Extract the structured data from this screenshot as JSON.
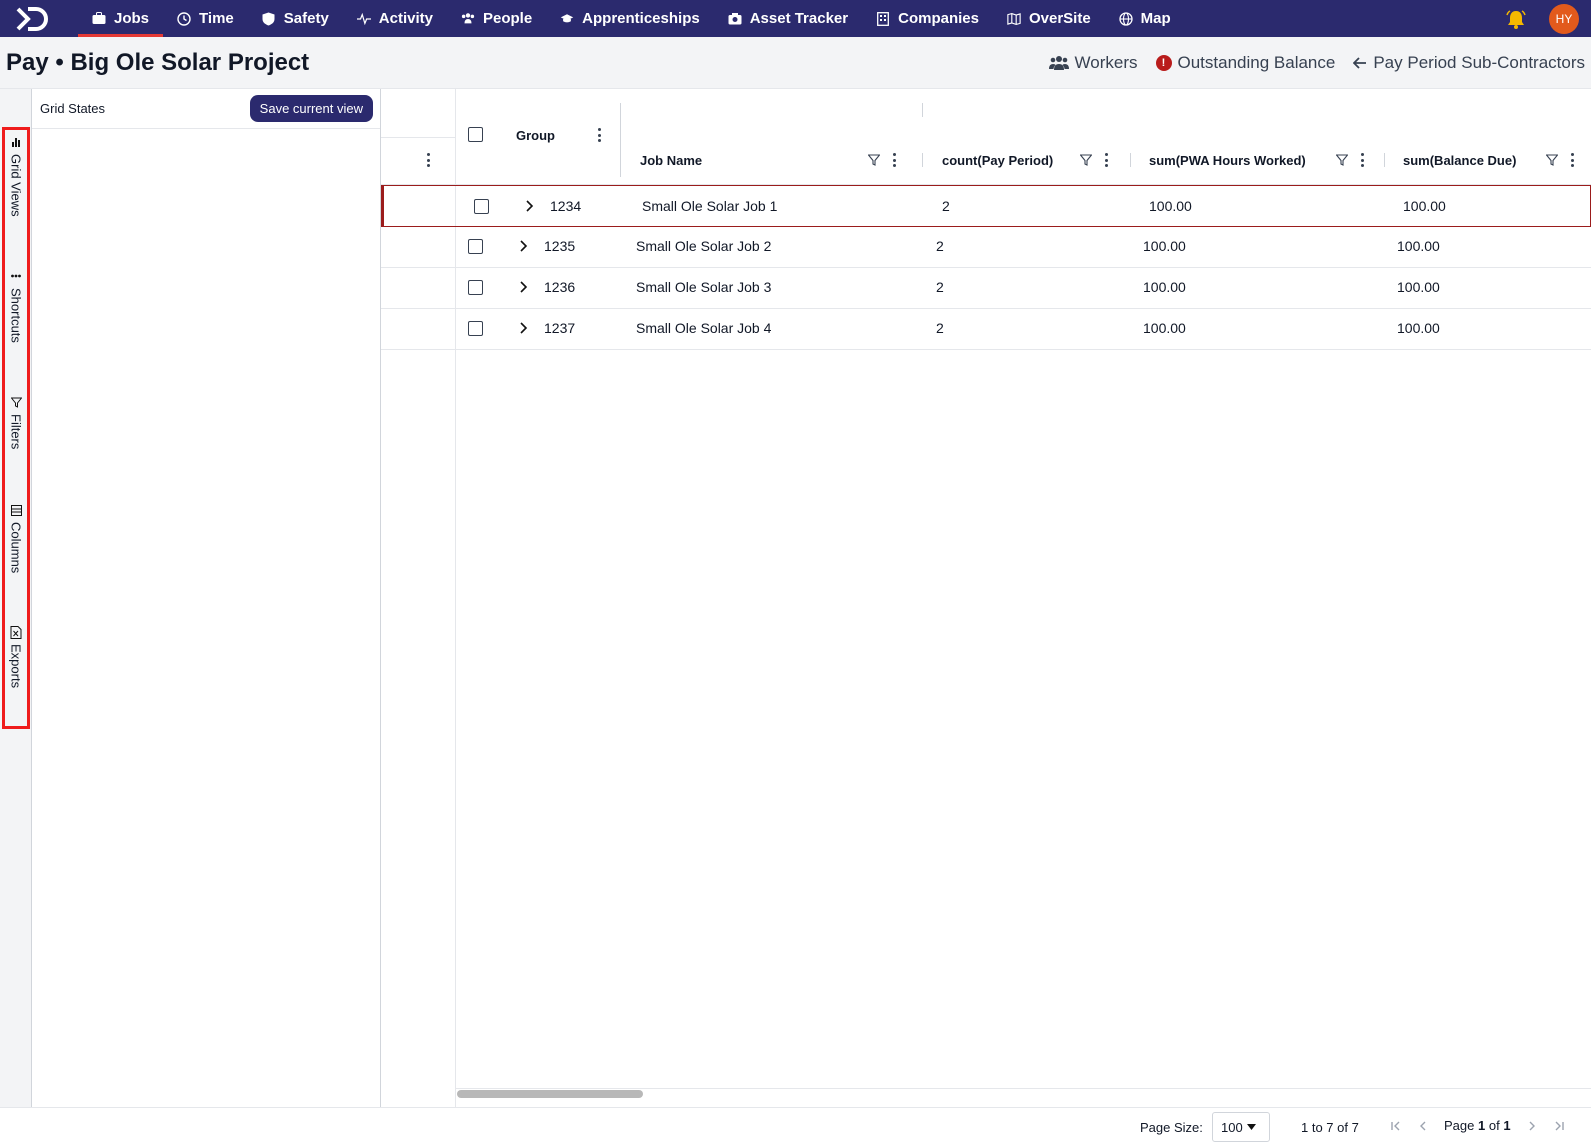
{
  "nav": {
    "items": [
      {
        "label": "Jobs",
        "icon": "briefcase-icon",
        "active": true
      },
      {
        "label": "Time",
        "icon": "clock-icon"
      },
      {
        "label": "Safety",
        "icon": "shield-icon"
      },
      {
        "label": "Activity",
        "icon": "pulse-icon"
      },
      {
        "label": "People",
        "icon": "people-icon"
      },
      {
        "label": "Apprenticeships",
        "icon": "graduation-cap-icon"
      },
      {
        "label": "Asset Tracker",
        "icon": "camera-icon"
      },
      {
        "label": "Companies",
        "icon": "building-icon"
      },
      {
        "label": "OverSite",
        "icon": "map-fold-icon"
      },
      {
        "label": "Map",
        "icon": "globe-icon"
      }
    ],
    "avatar_initials": "HY",
    "brand_color": "#2b2a6e",
    "accent_color": "#e53935"
  },
  "header": {
    "title": "Pay • Big Ole Solar Project",
    "actions": {
      "workers": "Workers",
      "outstanding": "Outstanding Balance",
      "alert_symbol": "!",
      "subcontractors": "Pay Period Sub-Contractors"
    }
  },
  "side_tabs": [
    {
      "label": "Grid Views",
      "icon": "bar-chart-icon"
    },
    {
      "label": "Shortcuts",
      "icon": "dots-icon"
    },
    {
      "label": "Filters",
      "icon": "filter-icon"
    },
    {
      "label": "Columns",
      "icon": "columns-icon"
    },
    {
      "label": "Exports",
      "icon": "excel-icon"
    }
  ],
  "grid_states": {
    "title": "Grid States",
    "save_label": "Save current view"
  },
  "grid": {
    "columns": {
      "group": "Group",
      "job_name": "Job Name",
      "count": "count(Pay Period)",
      "hours": "sum(PWA Hours Worked)",
      "balance": "sum(Balance Due)"
    },
    "rows": [
      {
        "group": "1234",
        "job_name": "Small Ole Solar Job 1",
        "count": "2",
        "hours": "100.00",
        "balance": "100.00"
      },
      {
        "group": "1235",
        "job_name": "Small Ole Solar Job 2",
        "count": "2",
        "hours": "100.00",
        "balance": "100.00"
      },
      {
        "group": "1236",
        "job_name": "Small Ole Solar Job 3",
        "count": "2",
        "hours": "100.00",
        "balance": "100.00"
      },
      {
        "group": "1237",
        "job_name": "Small Ole Solar Job 4",
        "count": "2",
        "hours": "100.00",
        "balance": "100.00"
      }
    ]
  },
  "footer": {
    "page_size_label": "Page Size:",
    "page_size_value": "100",
    "range_text": "1 to 7 of 7",
    "page_prefix": "Page",
    "page_current": "1",
    "page_of": "of",
    "page_total": "1"
  }
}
